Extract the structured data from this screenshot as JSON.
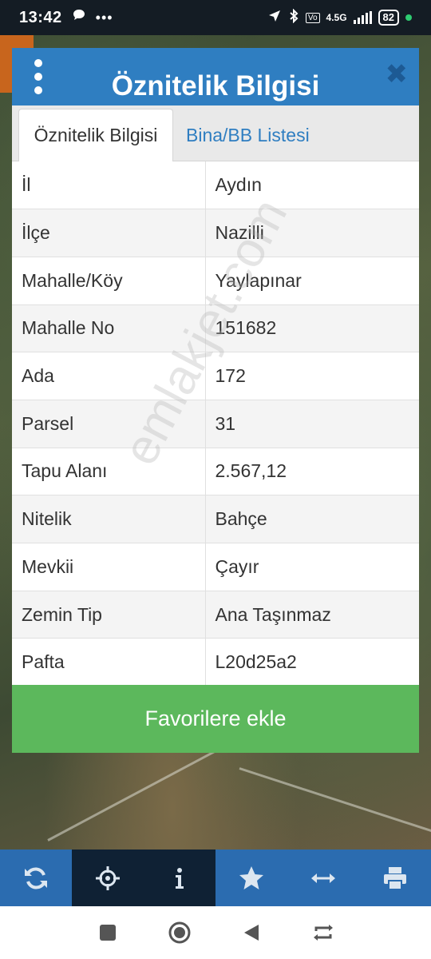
{
  "status_bar": {
    "time": "13:42",
    "network": "4.5G",
    "battery": "82"
  },
  "dialog": {
    "title": "Öznitelik Bilgisi",
    "close_icon": "close-icon",
    "tabs": [
      {
        "label": "Öznitelik Bilgisi",
        "active": true
      },
      {
        "label": "Bina/BB Listesi",
        "active": false
      }
    ],
    "rows": [
      {
        "key": "İl",
        "value": "Aydın"
      },
      {
        "key": "İlçe",
        "value": "Nazilli"
      },
      {
        "key": "Mahalle/Köy",
        "value": "Yaylapınar"
      },
      {
        "key": "Mahalle No",
        "value": "151682"
      },
      {
        "key": "Ada",
        "value": "172"
      },
      {
        "key": "Parsel",
        "value": "31"
      },
      {
        "key": "Tapu Alanı",
        "value": "2.567,12"
      },
      {
        "key": "Nitelik",
        "value": "Bahçe"
      },
      {
        "key": "Mevkii",
        "value": "Çayır"
      },
      {
        "key": "Zemin Tip",
        "value": "Ana Taşınmaz"
      },
      {
        "key": "Pafta",
        "value": "L20d25a2"
      }
    ],
    "favorite_button": "Favorilere ekle"
  },
  "watermark": "emlakjet.com",
  "toolbar": {
    "items": [
      "refresh-icon",
      "locate-icon",
      "info-icon",
      "star-icon",
      "measure-icon",
      "print-icon"
    ]
  },
  "colors": {
    "header_blue": "#2f7ec1",
    "button_green": "#5cb85c",
    "toolbar_blue": "#2b6cb0",
    "toolbar_active": "#0f2134"
  }
}
